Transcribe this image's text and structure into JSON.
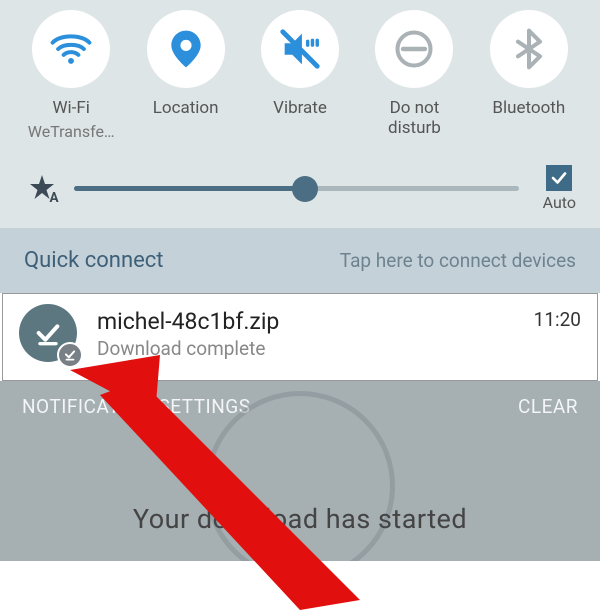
{
  "toggles": {
    "wifi": {
      "label": "Wi-Fi",
      "sub": "WeTransfe…",
      "active": true
    },
    "location": {
      "label": "Location",
      "active": true
    },
    "vibrate": {
      "label": "Vibrate",
      "active": true
    },
    "dnd": {
      "label": "Do not\ndisturb",
      "active": false
    },
    "bluetooth": {
      "label": "Bluetooth",
      "active": false
    }
  },
  "brightness": {
    "auto_label": "Auto",
    "auto_checked": true,
    "value_pct": 52
  },
  "quick_connect": {
    "title": "Quick connect",
    "hint": "Tap here to connect devices"
  },
  "notification": {
    "title": "michel-48c1bf.zip",
    "subtitle": "Download complete",
    "time": "11:20"
  },
  "actions": {
    "settings": "NOTIFICATION SETTINGS",
    "clear": "CLEAR"
  },
  "background_text": "Your download has started",
  "colors": {
    "accent_on": "#2b8fdc",
    "panel": "#dee5e7",
    "circle_off": "#aab2b5"
  }
}
